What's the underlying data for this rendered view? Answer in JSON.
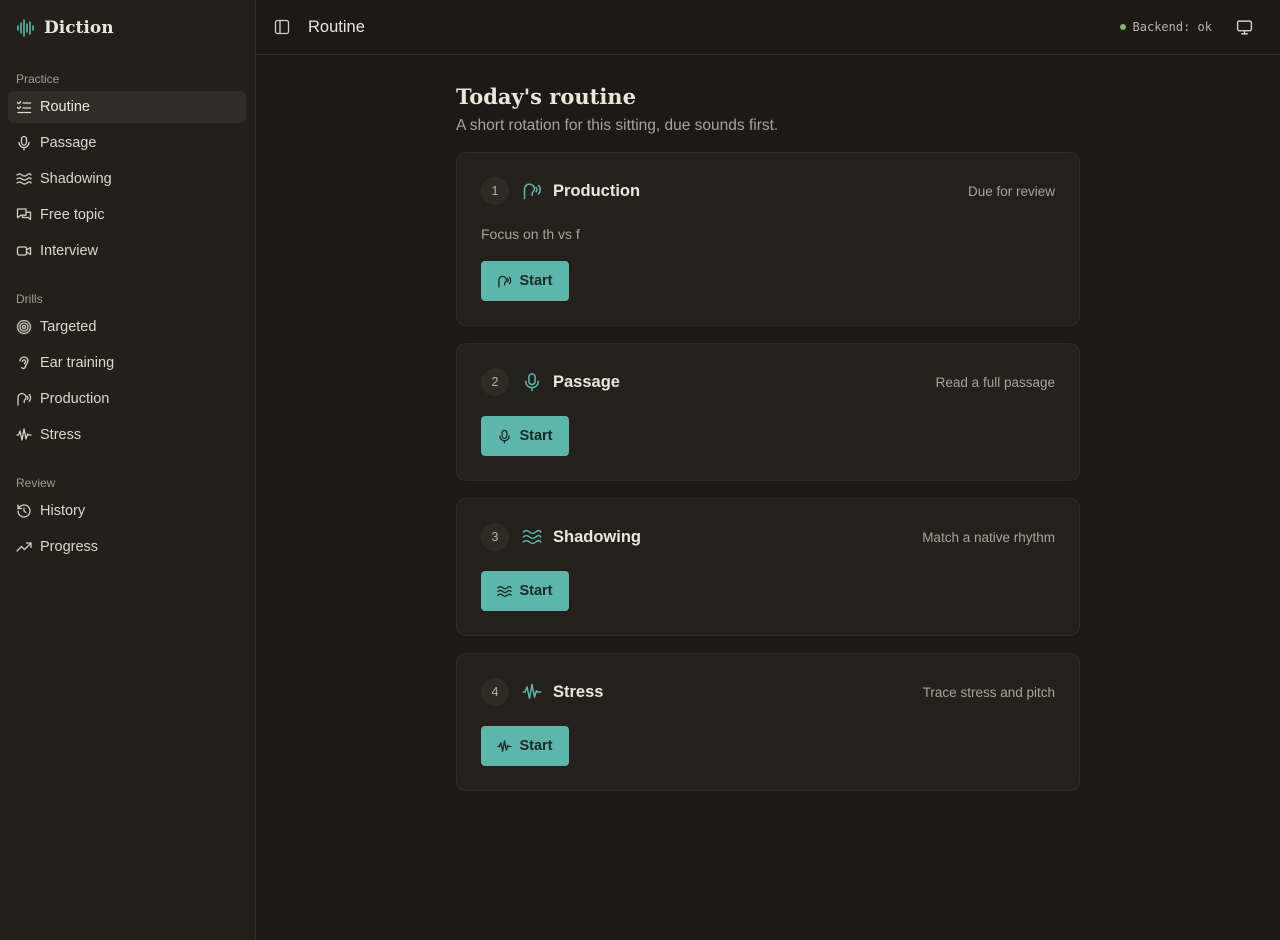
{
  "app": {
    "name": "Diction"
  },
  "sidebar": {
    "groups": [
      {
        "label": "Practice",
        "items": [
          {
            "label": "Routine",
            "icon": "list-checks-icon",
            "active": true
          },
          {
            "label": "Passage",
            "icon": "mic-icon"
          },
          {
            "label": "Shadowing",
            "icon": "waves-icon"
          },
          {
            "label": "Free topic",
            "icon": "chat-icon"
          },
          {
            "label": "Interview",
            "icon": "video-icon"
          }
        ]
      },
      {
        "label": "Drills",
        "items": [
          {
            "label": "Targeted",
            "icon": "target-icon"
          },
          {
            "label": "Ear training",
            "icon": "ear-icon"
          },
          {
            "label": "Production",
            "icon": "speech-icon"
          },
          {
            "label": "Stress",
            "icon": "waveform-icon"
          }
        ]
      },
      {
        "label": "Review",
        "items": [
          {
            "label": "History",
            "icon": "history-icon"
          },
          {
            "label": "Progress",
            "icon": "trending-up-icon"
          }
        ]
      }
    ]
  },
  "topbar": {
    "title": "Routine",
    "status": "Backend: ok"
  },
  "main": {
    "title": "Today's routine",
    "subtitle": "A short rotation for this sitting, due sounds first.",
    "cards": [
      {
        "number": "1",
        "title": "Production",
        "meta": "Due for review",
        "note": "Focus on th vs f",
        "button": "Start",
        "icon": "speech-icon"
      },
      {
        "number": "2",
        "title": "Passage",
        "meta": "Read a full passage",
        "button": "Start",
        "icon": "mic-icon"
      },
      {
        "number": "3",
        "title": "Shadowing",
        "meta": "Match a native rhythm",
        "button": "Start",
        "icon": "waves-icon"
      },
      {
        "number": "4",
        "title": "Stress",
        "meta": "Trace stress and pitch",
        "button": "Start",
        "icon": "waveform-icon"
      }
    ]
  },
  "colors": {
    "accent": "#5eb5aa",
    "status_ok": "#7fb56a",
    "background": "#1c1a17",
    "sidebar": "#23201c"
  }
}
